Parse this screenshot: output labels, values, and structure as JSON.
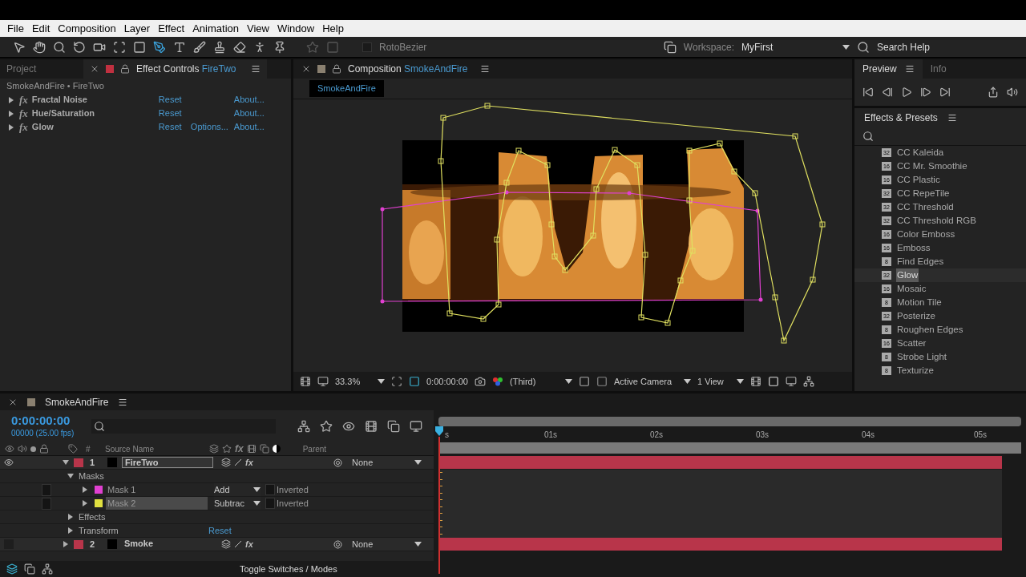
{
  "menu": [
    "File",
    "Edit",
    "Composition",
    "Layer",
    "Effect",
    "Animation",
    "View",
    "Window",
    "Help"
  ],
  "toolbar": {
    "rotobezier": {
      "label": "RotoBezier",
      "checked": false
    },
    "workspace_label": "Workspace:",
    "workspace": "MyFirst",
    "search": "Search Help"
  },
  "left_panel": {
    "tabs": [
      {
        "label": "Project",
        "selected": false
      },
      {
        "label": "Effect Controls",
        "target": "FireTwo",
        "selected": true
      }
    ],
    "breadcrumb": "SmokeAndFire • FireTwo",
    "effects": [
      {
        "badge": "fx",
        "name": "Fractal Noise",
        "reset": "Reset",
        "about": "About..."
      },
      {
        "badge": "fx",
        "name": "Hue/Saturation",
        "reset": "Reset",
        "about": "About..."
      },
      {
        "badge": "fx",
        "name": "Glow",
        "reset": "Reset",
        "options": "Options...",
        "about": "About..."
      }
    ]
  },
  "composition": {
    "tab": "Composition",
    "name": "SmokeAndFire",
    "flow_tab": "SmokeAndFire",
    "zoom": "33.3%",
    "time": "0:00:00:00",
    "resolution": "(Third)",
    "camera": "Active Camera",
    "views": "1 View"
  },
  "right_panel": {
    "tabs": [
      {
        "label": "Preview",
        "selected": true
      },
      {
        "label": "Info",
        "selected": false
      }
    ],
    "presets_title": "Effects & Presets",
    "presets": [
      {
        "bits": "32",
        "name": "CC Kaleida",
        "selected": false
      },
      {
        "bits": "16",
        "name": "CC Mr. Smoothie",
        "selected": false
      },
      {
        "bits": "16",
        "name": "CC Plastic",
        "selected": false
      },
      {
        "bits": "32",
        "name": "CC RepeTile",
        "selected": false
      },
      {
        "bits": "32",
        "name": "CC Threshold",
        "selected": false
      },
      {
        "bits": "32",
        "name": "CC Threshold RGB",
        "selected": false
      },
      {
        "bits": "16",
        "name": "Color Emboss",
        "selected": false
      },
      {
        "bits": "16",
        "name": "Emboss",
        "selected": false
      },
      {
        "bits": "8",
        "name": "Find Edges",
        "selected": false
      },
      {
        "bits": "32",
        "name": "Glow",
        "selected": true
      },
      {
        "bits": "16",
        "name": "Mosaic",
        "selected": false
      },
      {
        "bits": "8",
        "name": "Motion Tile",
        "selected": false
      },
      {
        "bits": "32",
        "name": "Posterize",
        "selected": false
      },
      {
        "bits": "8",
        "name": "Roughen Edges",
        "selected": false
      },
      {
        "bits": "16",
        "name": "Scatter",
        "selected": false
      },
      {
        "bits": "8",
        "name": "Strobe Light",
        "selected": false
      },
      {
        "bits": "8",
        "name": "Texturize",
        "selected": false
      }
    ]
  },
  "timeline": {
    "tab": "SmokeAndFire",
    "timecode": "0:00:00:00",
    "fps": "00000 (25.00 fps)",
    "columns": {
      "number": "#",
      "source": "Source Name",
      "fx": "fx",
      "parent": "Parent"
    },
    "ruler": [
      "s",
      "01s",
      "02s",
      "03s",
      "04s",
      "05s"
    ],
    "layers": [
      {
        "kind": "layer",
        "number": "1",
        "name": "FireTwo",
        "color": "#b8354a",
        "visible": true,
        "expanded": true,
        "renaming": true,
        "switch_fx": "fx",
        "parent": "None",
        "children": [
          {
            "kind": "group",
            "name": "Masks",
            "expanded": true,
            "children": [
              {
                "kind": "mask",
                "name": "Mask 1",
                "color": "#e040d0",
                "mode": "Add",
                "inverted": "Inverted",
                "checked": false,
                "selected": false
              },
              {
                "kind": "mask",
                "name": "Mask 2",
                "color": "#e0e040",
                "mode": "Subtrac",
                "inverted": "Inverted",
                "checked": false,
                "selected": true
              }
            ]
          },
          {
            "kind": "group",
            "name": "Effects",
            "expanded": false
          },
          {
            "kind": "group",
            "name": "Transform",
            "expanded": false,
            "reset": "Reset"
          }
        ]
      },
      {
        "kind": "layer",
        "number": "2",
        "name": "Smoke",
        "color": "#b8354a",
        "visible": false,
        "expanded": false,
        "renaming": false,
        "switch_fx": "fx",
        "parent": "None"
      }
    ],
    "footer": "Toggle Switches / Modes"
  }
}
